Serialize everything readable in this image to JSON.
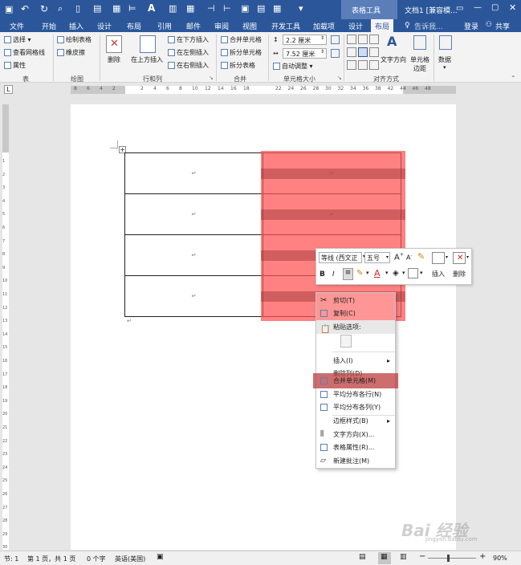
{
  "titlebar": {
    "context_tab": "表格工具",
    "doc_title": "文档1 [兼容模..."
  },
  "tabs": [
    "文件",
    "开始",
    "插入",
    "设计",
    "布局",
    "引用",
    "邮件",
    "审阅",
    "视图",
    "开发工具",
    "加载项",
    "设计",
    "布局"
  ],
  "tab_right": {
    "tellme": "告诉我...",
    "login": "登录",
    "share": "共享"
  },
  "ribbon": {
    "table": {
      "select": "选择",
      "gridlines": "查看网格线",
      "properties": "属性",
      "label": "表"
    },
    "draw": {
      "draw_table": "绘制表格",
      "eraser": "橡皮擦",
      "label": "绘图"
    },
    "rowscols": {
      "delete": "删除",
      "insert_above": "在上方插入",
      "insert_below": "在下方插入",
      "insert_left": "在左侧插入",
      "insert_right": "在右侧插入",
      "label": "行和列"
    },
    "merge": {
      "merge_cells": "合并单元格",
      "split_cells": "拆分单元格",
      "split_table": "拆分表格",
      "label": "合并"
    },
    "cellsize": {
      "height": "2.2 厘米",
      "width": "7.52 厘米",
      "autofit": "自动调整",
      "label": "单元格大小"
    },
    "align": {
      "text_direction": "文字方向",
      "cell_margins": "单元格边距",
      "label": "对齐方式"
    },
    "data": {
      "label": "数据"
    }
  },
  "ruler": {
    "left_nums": [
      "8",
      "6",
      "4",
      "2"
    ],
    "right_nums": [
      "2",
      "4",
      "6",
      "8",
      "10",
      "12",
      "14",
      "16",
      "18",
      "22",
      "24",
      "26",
      "28",
      "30",
      "32",
      "34",
      "36",
      "38",
      "42",
      "44",
      "46",
      "48"
    ],
    "vnums": [
      "1",
      "2",
      "3",
      "4",
      "5",
      "6",
      "7",
      "8",
      "9",
      "10",
      "11",
      "12",
      "13",
      "14",
      "15",
      "16",
      "17",
      "18",
      "19",
      "20",
      "21",
      "22",
      "23",
      "24",
      "25",
      "26",
      "27",
      "28",
      "29",
      "30"
    ]
  },
  "doc": {
    "para_mark": "↵"
  },
  "minitoolbar": {
    "font": "等线 (西文正",
    "size": "五号",
    "insert": "插入",
    "delete": "删除"
  },
  "context_menu": {
    "items": [
      {
        "label": "剪切(T)",
        "icon": "scissors-icon"
      },
      {
        "label": "复制(C)",
        "icon": "copy-icon"
      },
      {
        "label": "粘贴选项:",
        "icon": ""
      },
      {
        "label": "插入(I)",
        "icon": ""
      },
      {
        "label": "删除列(D)",
        "icon": ""
      },
      {
        "label": "合并单元格(M)",
        "icon": "merge-cells-icon"
      },
      {
        "label": "平均分布各行(N)",
        "icon": "distribute-rows-icon"
      },
      {
        "label": "平均分布各列(Y)",
        "icon": "distribute-cols-icon"
      },
      {
        "label": "边框样式(B)",
        "icon": ""
      },
      {
        "label": "文字方向(X)...",
        "icon": "text-direction-icon"
      },
      {
        "label": "表格属性(R)...",
        "icon": "table-properties-icon"
      },
      {
        "label": "新建批注(M)",
        "icon": "comment-icon"
      }
    ]
  },
  "status": {
    "section": "节: 1",
    "page": "第 1 页，共 1 页",
    "words": "0 个字",
    "lang": "英语(美国)",
    "zoom": "90%"
  },
  "watermark": "Bai 经验",
  "watermark_sub": "jingyan.baidu.com"
}
